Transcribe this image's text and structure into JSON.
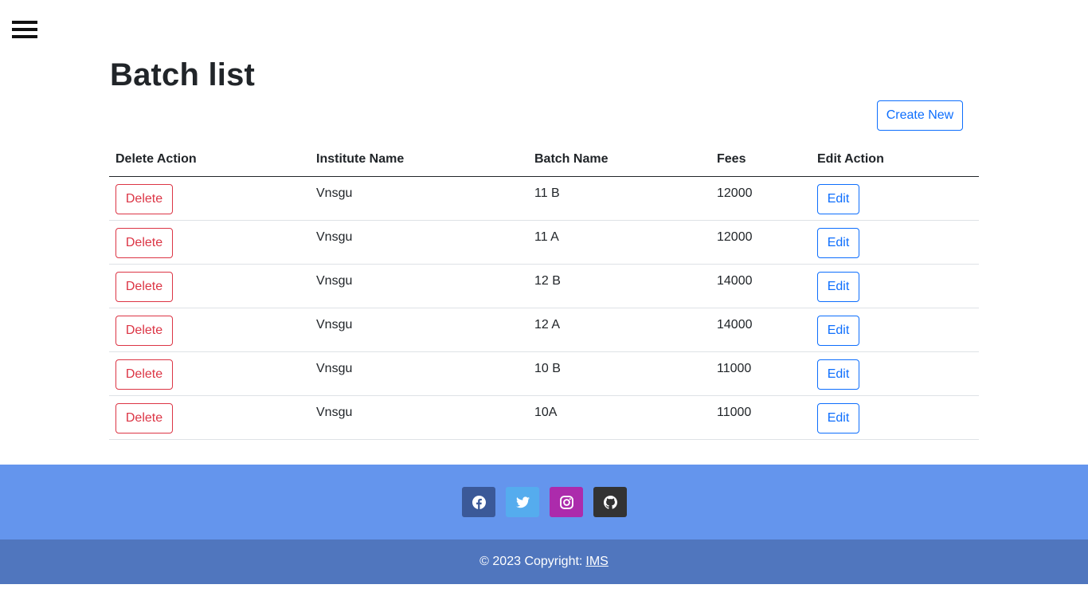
{
  "header": {
    "menu_icon": "hamburger-menu-icon"
  },
  "page": {
    "title": "Batch list",
    "create_label": "Create New"
  },
  "table": {
    "headers": [
      "Delete Action",
      "Institute Name",
      "Batch Name",
      "Fees",
      "Edit Action"
    ],
    "delete_label": "Delete",
    "edit_label": "Edit",
    "rows": [
      {
        "institute": "Vnsgu",
        "batch": "11 B",
        "fees": "12000"
      },
      {
        "institute": "Vnsgu",
        "batch": "11 A",
        "fees": "12000"
      },
      {
        "institute": "Vnsgu",
        "batch": "12 B",
        "fees": "14000"
      },
      {
        "institute": "Vnsgu",
        "batch": "12 A",
        "fees": "14000"
      },
      {
        "institute": "Vnsgu",
        "batch": "10 B",
        "fees": "11000"
      },
      {
        "institute": "Vnsgu",
        "batch": "10A",
        "fees": "11000"
      }
    ]
  },
  "footer": {
    "socials": [
      {
        "name": "facebook-icon",
        "color": "#3b5998"
      },
      {
        "name": "twitter-icon",
        "color": "#55acee"
      },
      {
        "name": "instagram-icon",
        "color": "#ac2bac"
      },
      {
        "name": "github-icon",
        "color": "#333333"
      }
    ],
    "copyright": "© 2023 Copyright:",
    "link_label": "IMS"
  },
  "colors": {
    "primary": "#0d6efd",
    "danger": "#dc3545",
    "footer_top": "#6495ed",
    "footer_bottom": "#5076be"
  }
}
